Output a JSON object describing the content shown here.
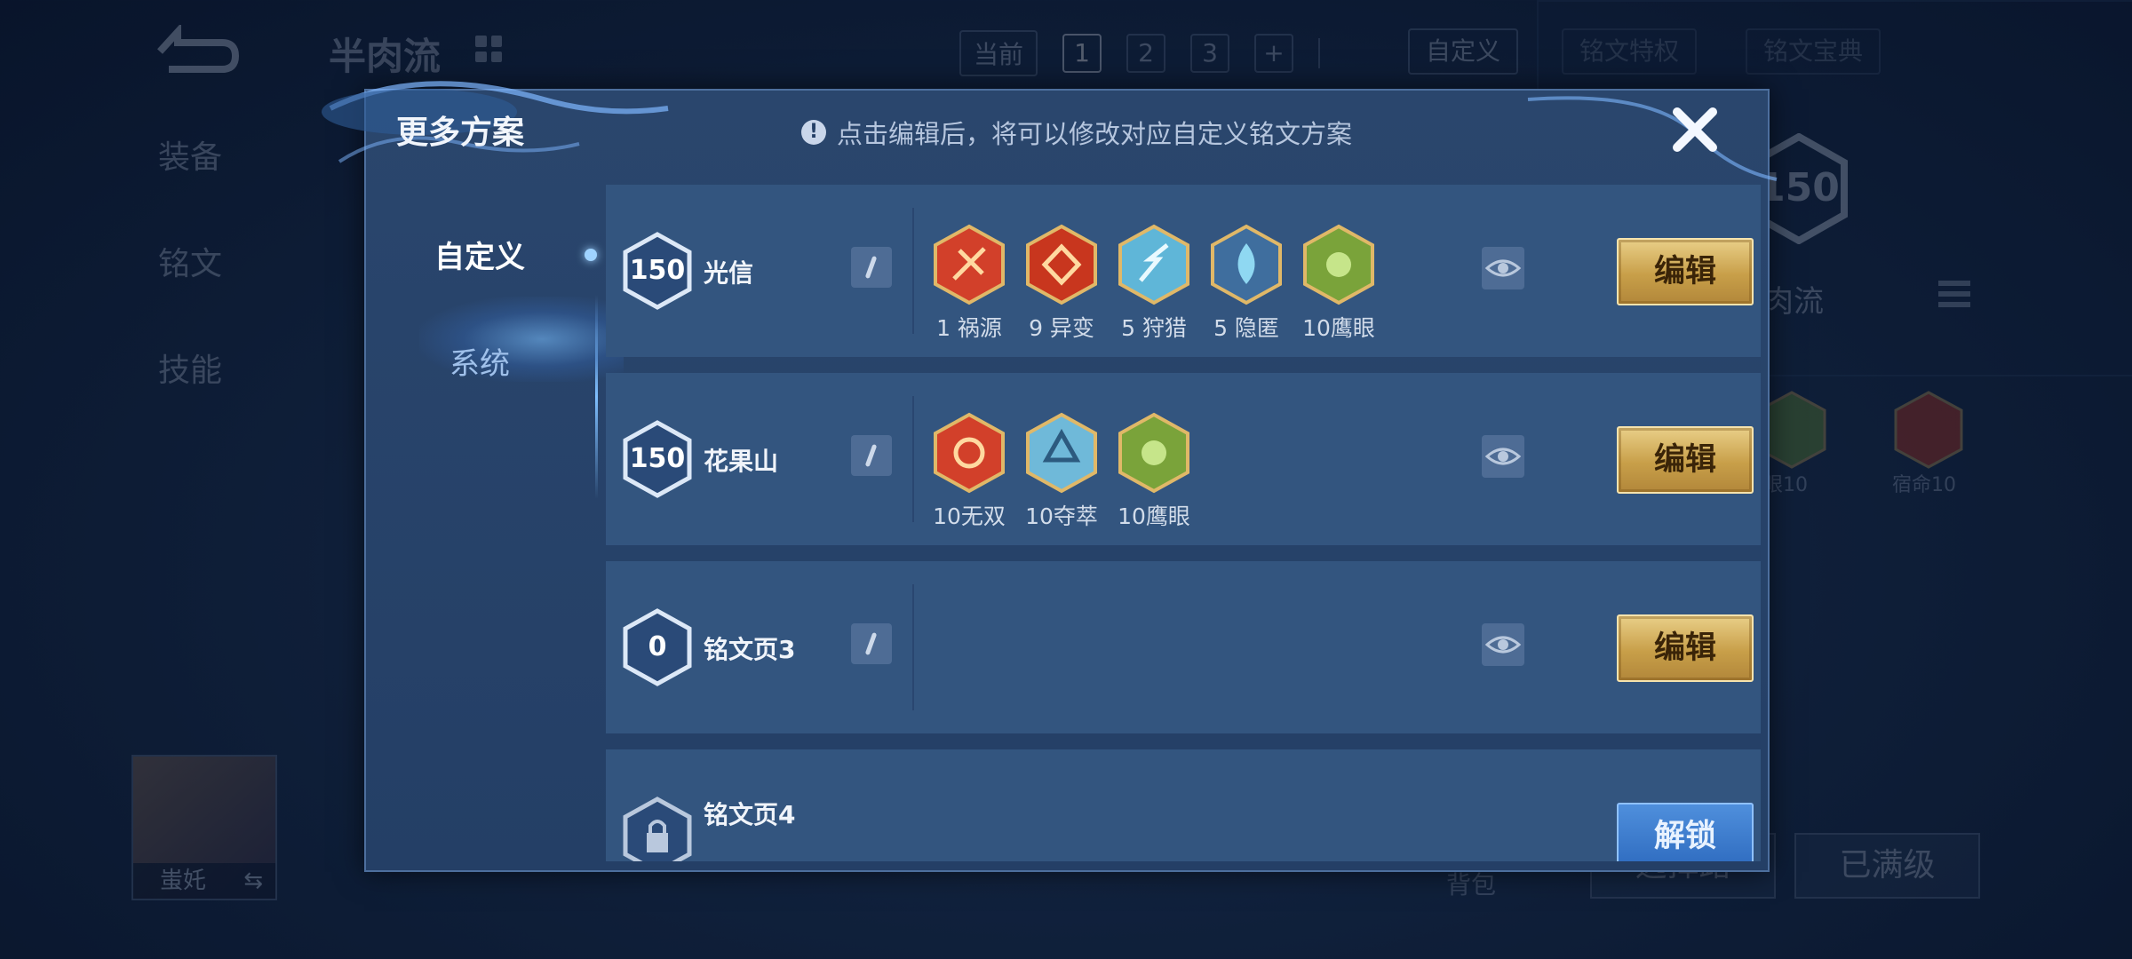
{
  "background": {
    "build_title": "半肉流",
    "page_tabs": {
      "current_label": "当前",
      "pages": [
        "1",
        "2",
        "3"
      ],
      "active": "1",
      "add": "+"
    },
    "custom_label": "自定义",
    "rune_privilege": "铭文特权",
    "rune_encyclopedia": "铭文宝典",
    "left_menu": [
      "装备",
      "铭文",
      "技能"
    ],
    "hero_name": "蚩奼",
    "swap_icon": "⇆",
    "build_level": "150",
    "build_name": "肉流",
    "rune_labels": [
      "眼10",
      "宿命10"
    ],
    "bag_label": "背包",
    "select_button": "选择路",
    "maxed_button": "已满级"
  },
  "modal": {
    "title": "更多方案",
    "notice": "点击编辑后，将可以修改对应自定义铭文方案",
    "notice_icon": "!",
    "sidebar": [
      {
        "label": "自定义",
        "active": true
      },
      {
        "label": "系统",
        "active": false
      }
    ],
    "pages": [
      {
        "level": "150",
        "name": "光信",
        "runes": [
          {
            "icon": "rune-huoyuan-icon",
            "label": "1 祸源",
            "color": "#d2402a"
          },
          {
            "icon": "rune-yibian-icon",
            "label": "9 异变",
            "color": "#c8361e"
          },
          {
            "icon": "rune-shoulie-icon",
            "label": "5 狩猎",
            "color": "#5fb6d8"
          },
          {
            "icon": "rune-yinni-icon",
            "label": "5 隐匿",
            "color": "#5fb6d8"
          },
          {
            "icon": "rune-yingyan-icon",
            "label": "10鹰眼",
            "color": "#7aa33a"
          }
        ],
        "action": "编辑"
      },
      {
        "level": "150",
        "name": "花果山",
        "runes": [
          {
            "icon": "rune-wushuang-icon",
            "label": "10无双",
            "color": "#d2402a"
          },
          {
            "icon": "rune-duocui-icon",
            "label": "10夺萃",
            "color": "#5fb6d8"
          },
          {
            "icon": "rune-yingyan-icon",
            "label": "10鹰眼",
            "color": "#7aa33a"
          }
        ],
        "action": "编辑"
      },
      {
        "level": "0",
        "name": "铭文页3",
        "runes": [],
        "action": "编辑"
      },
      {
        "level": "",
        "name": "铭文页4",
        "runes": [],
        "action": "解锁"
      }
    ]
  }
}
